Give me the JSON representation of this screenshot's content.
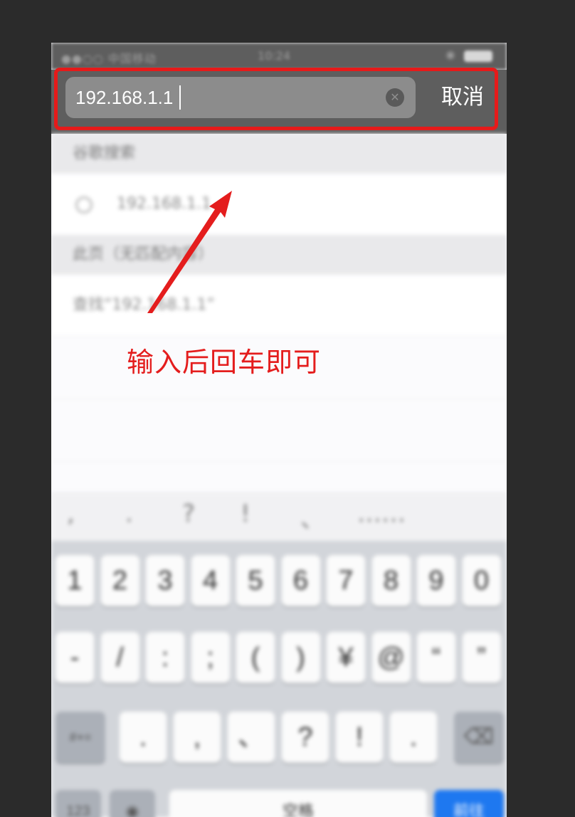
{
  "status_bar": {
    "carrier": "●●○○ 中国移动",
    "time": "10:24"
  },
  "search": {
    "value": "192.168.1.1",
    "cancel_label": "取消",
    "clear_icon": "clear-circle-icon"
  },
  "suggestions": {
    "google_header": "谷歌搜索",
    "google_item": "192.168.1.1",
    "page_header": "此页（无匹配内容）",
    "find_item": "查找“192.168.1.1”"
  },
  "annotation": {
    "label": "输入后回车即可",
    "color": "#e41d1d"
  },
  "keyboard": {
    "punct": [
      ",",
      ".",
      "?",
      "!",
      "、",
      "……"
    ],
    "row1": [
      "1",
      "2",
      "3",
      "4",
      "5",
      "6",
      "7",
      "8",
      "9",
      "0"
    ],
    "row2": [
      "-",
      "/",
      ":",
      ";",
      "(",
      ")",
      "¥",
      "@",
      "“",
      "”"
    ],
    "row3_left": "#+=",
    "row3": [
      ".",
      ",",
      "、",
      "?",
      "!",
      "."
    ],
    "row4_left": "123",
    "space": "空格",
    "return": "前往"
  },
  "colors": {
    "highlight": "#e61a1a",
    "header_bg": "#5e5e5e",
    "keyboard_bg": "#d2d5da"
  }
}
